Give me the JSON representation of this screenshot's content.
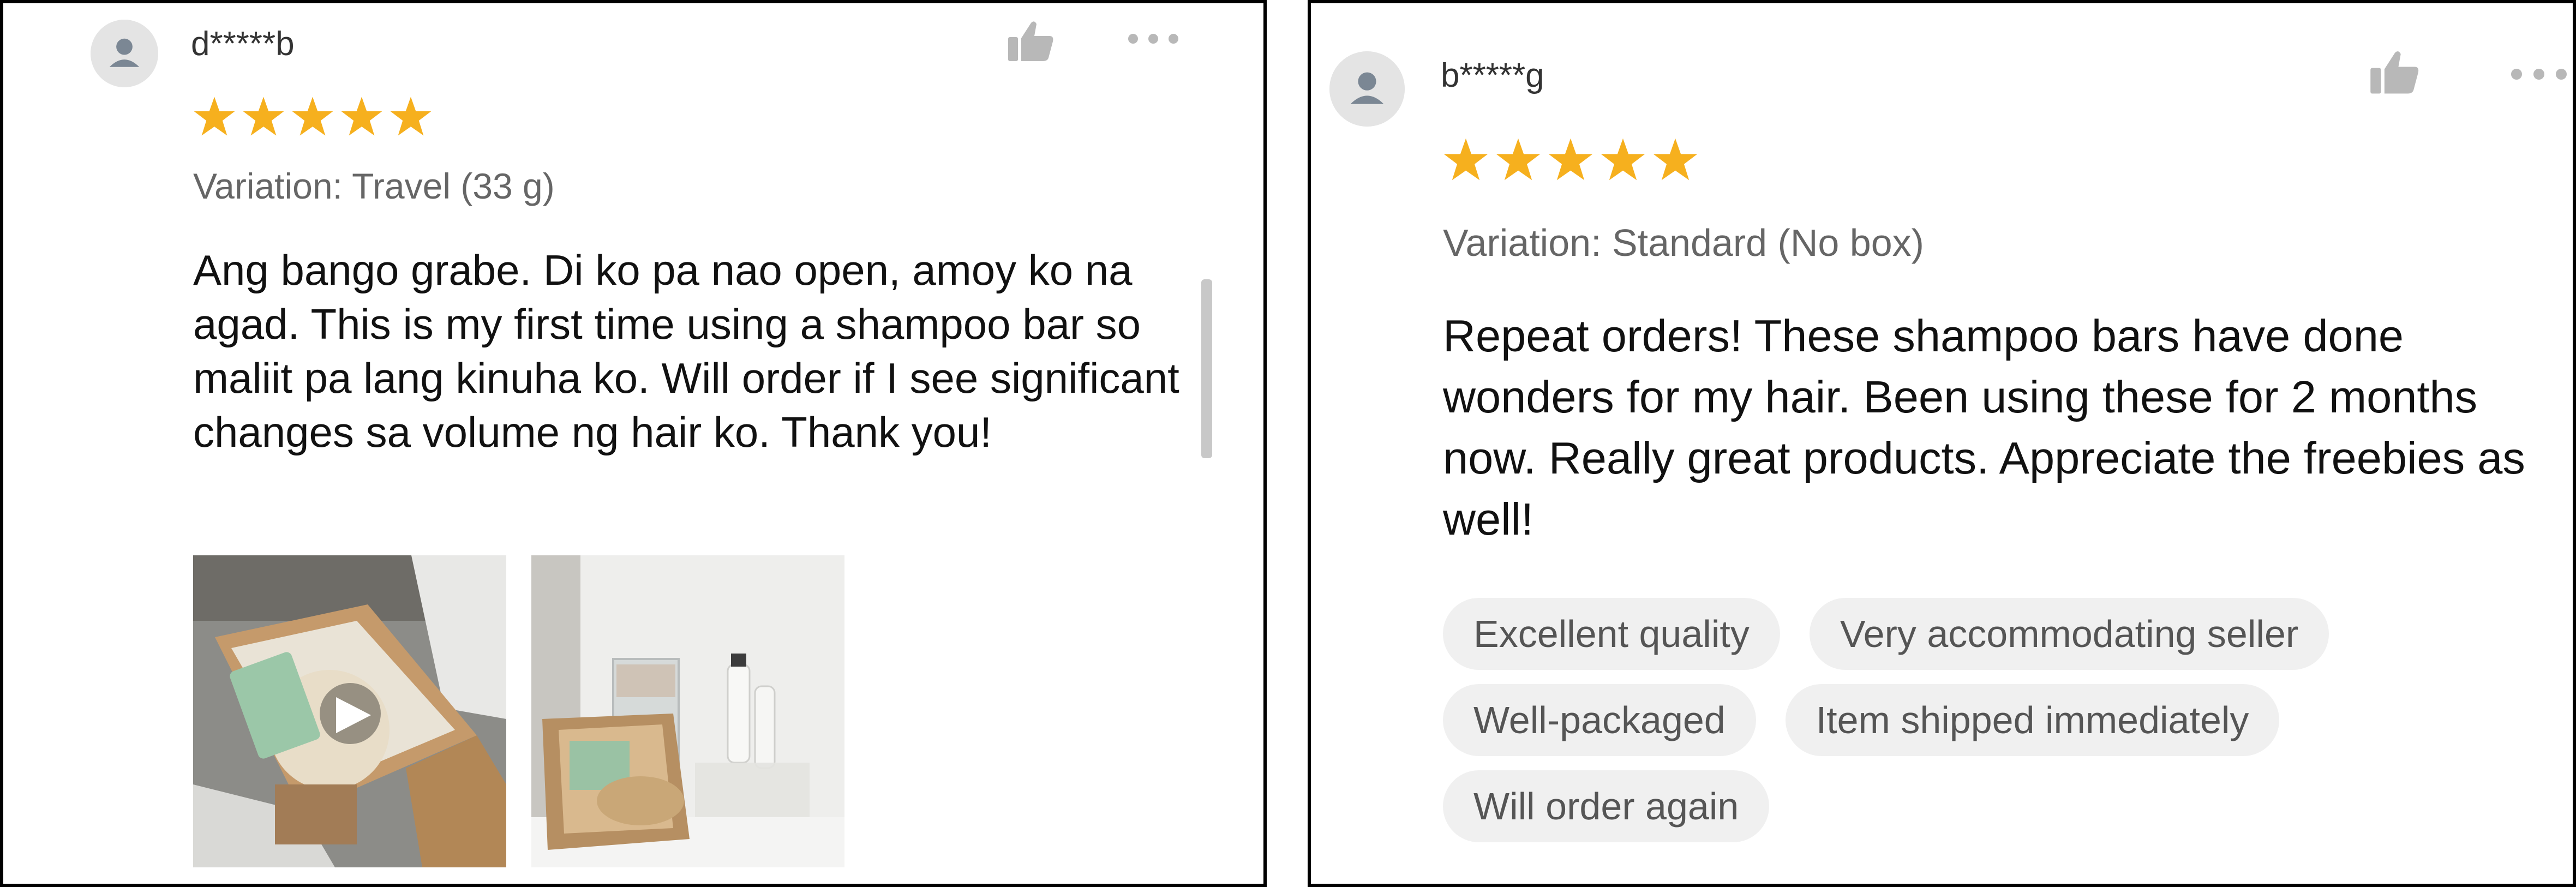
{
  "reviews": [
    {
      "username": "d*****b",
      "rating": 5,
      "variation": "Variation: Travel (33 g)",
      "text": "Ang bango grabe. Di ko pa nao open, amoy ko na agad. This is my first time using a shampoo bar so maliit pa lang kinuha ko. Will order if I see significant changes sa volume ng hair ko. Thank you!",
      "media": [
        {
          "kind": "video",
          "icon": "play-icon"
        },
        {
          "kind": "photo"
        }
      ]
    },
    {
      "username": "b*****g",
      "rating": 5,
      "variation": "Variation: Standard (No box)",
      "text": "Repeat orders! These shampoo bars have done wonders for my hair. Been using these for 2 months now. Really great products. Appreciate the freebies as well!",
      "tags": [
        "Excellent quality",
        "Very accommodating seller",
        "Well-packaged",
        "Item shipped immediately",
        "Will order again"
      ]
    }
  ],
  "icons": {
    "like": "thumbs-up-icon",
    "more": "more-options-icon",
    "avatar": "user-avatar-icon",
    "star": "star-icon"
  },
  "colors": {
    "star": "#F6B01E",
    "icon_gray": "#B8B8B8",
    "tag_bg": "#F0F0F0"
  }
}
